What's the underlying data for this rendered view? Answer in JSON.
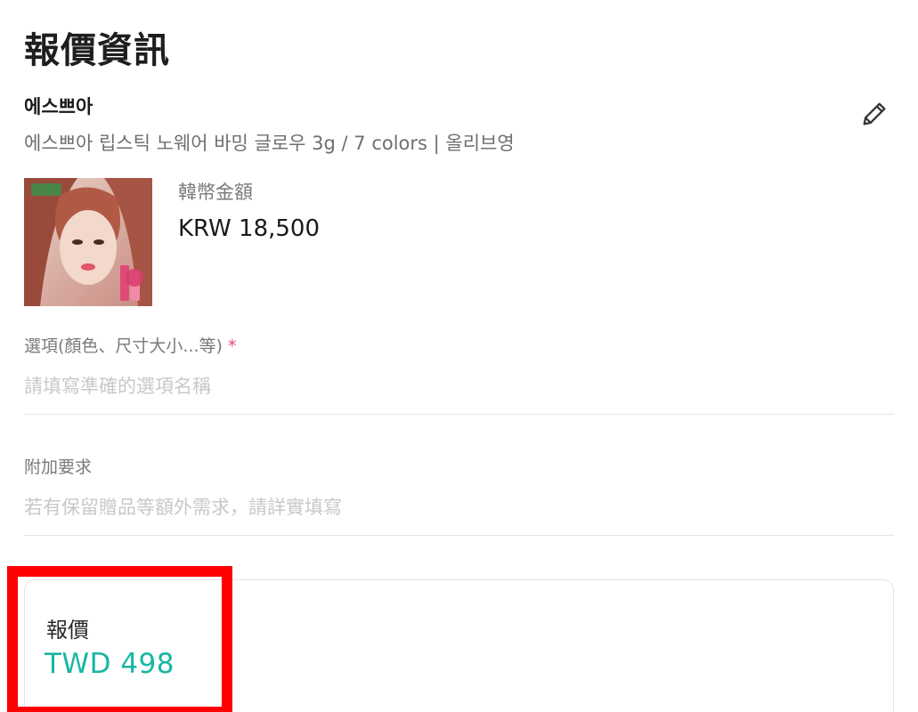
{
  "page": {
    "title": "報價資訊"
  },
  "product": {
    "brand": "에스쁘아",
    "name": "에스쁘아 립스틱 노웨어 바밍 글로우 3g / 7 colors | 올리브영",
    "image_icon": "product-photo",
    "price_label": "韓幣金額",
    "price_value": "KRW 18,500"
  },
  "edit": {
    "icon": "pencil-icon"
  },
  "option_field": {
    "label": "選項(顏色、尺寸大小...等)",
    "required_mark": "*",
    "placeholder": "請填寫準確的選項名稱",
    "value": ""
  },
  "extra_field": {
    "label": "附加要求",
    "placeholder": "若有保留贈品等額外需求，請詳實填寫",
    "value": ""
  },
  "quote": {
    "label": "報價",
    "value": "TWD 498"
  },
  "colors": {
    "accent": "#18b6a3",
    "required": "#e8466f",
    "highlight": "#ff0000"
  }
}
